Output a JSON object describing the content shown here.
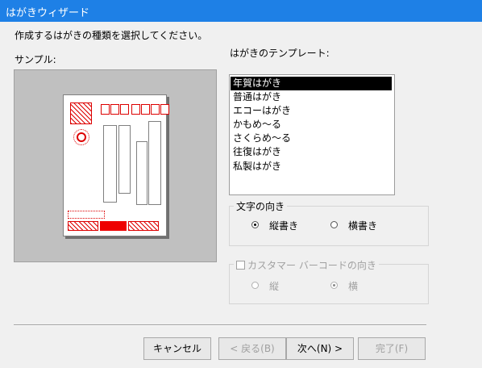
{
  "title": "はがきウィザード",
  "instruction": "作成するはがきの種類を選択してください。",
  "sample_label": "サンプル:",
  "template_label": "はがきのテンプレート:",
  "templates": [
    "年賀はがき",
    "普通はがき",
    "エコーはがき",
    "かもめ～る",
    "さくらめ～る",
    "往復はがき",
    "私製はがき"
  ],
  "selected_template": "年賀はがき",
  "text_direction": {
    "title": "文字の向き",
    "options": [
      "縦書き",
      "横書き"
    ],
    "selected": "縦書き"
  },
  "barcode_direction": {
    "title": "カスタマー バーコードの向き",
    "checked": false,
    "options": [
      "縦",
      "横"
    ],
    "selected": "横",
    "enabled": false
  },
  "buttons": {
    "cancel": "キャンセル",
    "back": "< 戻る(B)",
    "next": "次へ(N) >",
    "finish": "完了(F)"
  }
}
